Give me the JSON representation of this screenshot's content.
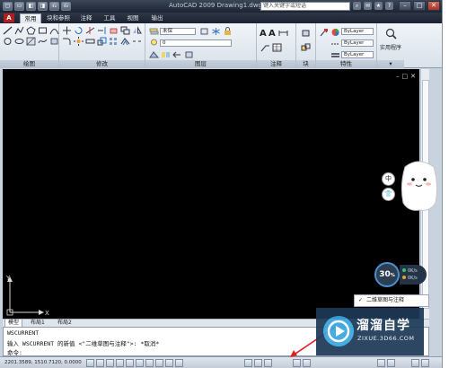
{
  "window": {
    "title": "AutoCAD 2009  Drawing1.dwg",
    "search_placeholder": "键入关键字或短语",
    "controls": [
      "–",
      "□",
      "✕"
    ]
  },
  "quick_access": [
    "▢",
    "▭",
    "◧",
    "◨",
    "⎌",
    "⎌"
  ],
  "ribbon_tabs": [
    "常用",
    "块和参照",
    "注释",
    "工具",
    "视图",
    "输出"
  ],
  "ribbon_panels": {
    "draw": "绘图",
    "modify": "修改",
    "layer": "图层",
    "annotation": "注释",
    "block": "块",
    "properties": "特性",
    "utilities_label": "实用程序"
  },
  "layer_dropdown": "未保",
  "layer_dropdown2": "0",
  "bylayer": "ByLayer",
  "canvas_controls": [
    "–",
    "□",
    "✕"
  ],
  "model_tabs": [
    "模型",
    "布局1",
    "布局2"
  ],
  "command_lines": [
    "WSCURRENT",
    "输入 WSCURRENT 的新值 <\"二维草图与注释\">: *取消*",
    "命令:"
  ],
  "status": {
    "coords": "2201.3589, 1510.7120, 0.0000"
  },
  "workspace_popup": {
    "check": "✓",
    "label": "二维草图与注释"
  },
  "overlay": {
    "zh_badge": "中",
    "speed_value": "30",
    "speed_unit": "%",
    "speed_line1": "0K/s",
    "speed_line2": "0K/s"
  },
  "ucs": {
    "x_label": "X",
    "y_label": "Y"
  },
  "watermark": {
    "title": "溜溜自学",
    "url": "ZIXUE.3D66.COM"
  },
  "colors": {
    "canvas": "#000000",
    "titlebar": "#1d2533",
    "accent_red": "#b31d1d",
    "watermark_bg": "#1e3a57"
  }
}
